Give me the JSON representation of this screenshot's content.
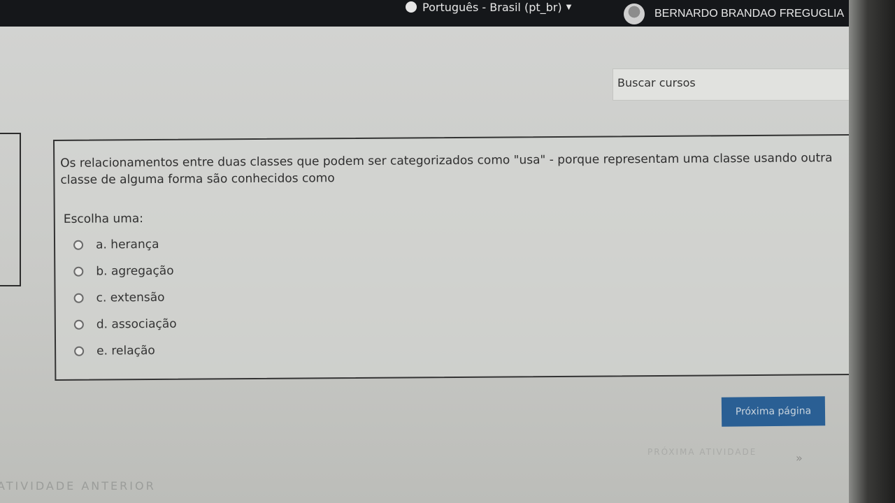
{
  "header": {
    "language": "Português - Brasil (pt_br)",
    "user_name": "BERNARDO BRANDAO FREGUGLIA"
  },
  "search": {
    "placeholder": "Buscar cursos"
  },
  "question": {
    "text": "Os relacionamentos entre duas classes que podem ser categorizados como \"usa\" - porque representam uma classe usando outra classe de alguma forma são conhecidos como",
    "prompt": "Escolha uma:",
    "options": [
      {
        "label": "a. herança"
      },
      {
        "label": "b. agregação"
      },
      {
        "label": "c. extensão"
      },
      {
        "label": "d. associação"
      },
      {
        "label": "e. relação"
      }
    ]
  },
  "navigation": {
    "next_page_label": "Próxima página",
    "next_activity_label": "PRÓXIMA ATIVIDADE",
    "prev_activity_label": "ATIVIDADE ANTERIOR"
  },
  "colors": {
    "navbar": "#15171a",
    "primary_button": "#2a5f94"
  }
}
